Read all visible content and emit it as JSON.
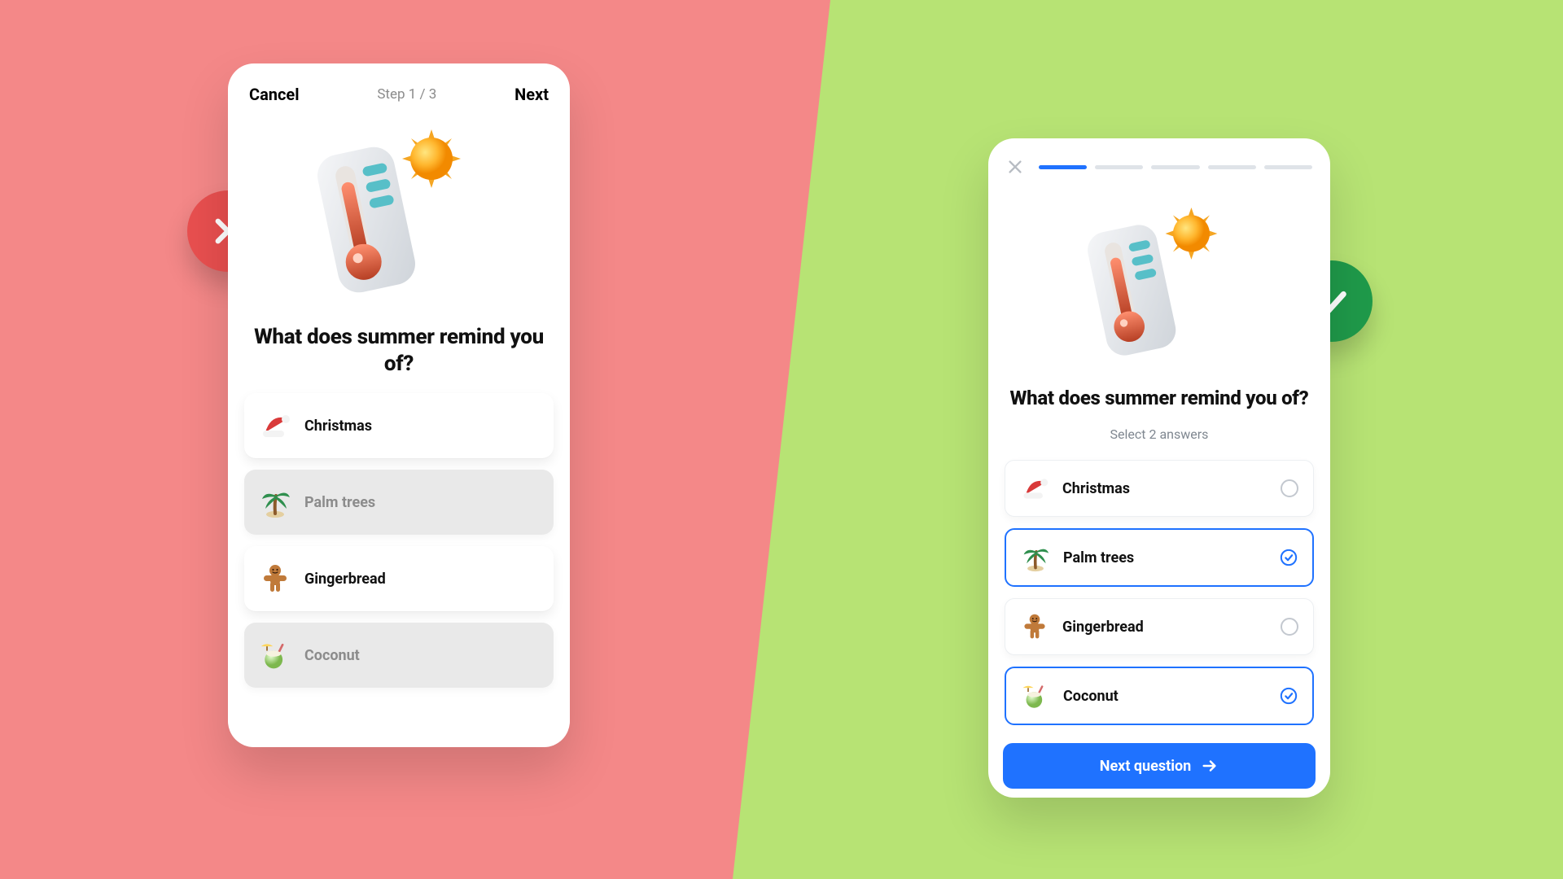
{
  "colors": {
    "bad_bg": "#f48888",
    "good_bg": "#b7e374",
    "primary": "#1f72ff",
    "bad": "#e84f4f",
    "good": "#1f9a4a"
  },
  "left_panel": {
    "cancel": "Cancel",
    "step": "Step 1 / 3",
    "next": "Next",
    "question": "What does summer remind you of?",
    "options": [
      {
        "id": "christmas",
        "label": "Christmas",
        "icon": "santa-hat",
        "selected": false
      },
      {
        "id": "palm",
        "label": "Palm trees",
        "icon": "palm-tree",
        "selected": true
      },
      {
        "id": "ginger",
        "label": "Gingerbread",
        "icon": "gingerbread",
        "selected": false
      },
      {
        "id": "coconut",
        "label": "Coconut",
        "icon": "coconut",
        "selected": true
      }
    ]
  },
  "right_panel": {
    "progress": {
      "current": 1,
      "total": 5
    },
    "question": "What does summer remind you of?",
    "subtitle": "Select 2 answers",
    "cta": "Next question",
    "options": [
      {
        "id": "christmas",
        "label": "Christmas",
        "icon": "santa-hat",
        "selected": false
      },
      {
        "id": "palm",
        "label": "Palm trees",
        "icon": "palm-tree",
        "selected": true
      },
      {
        "id": "ginger",
        "label": "Gingerbread",
        "icon": "gingerbread",
        "selected": false
      },
      {
        "id": "coconut",
        "label": "Coconut",
        "icon": "coconut",
        "selected": true
      }
    ]
  }
}
